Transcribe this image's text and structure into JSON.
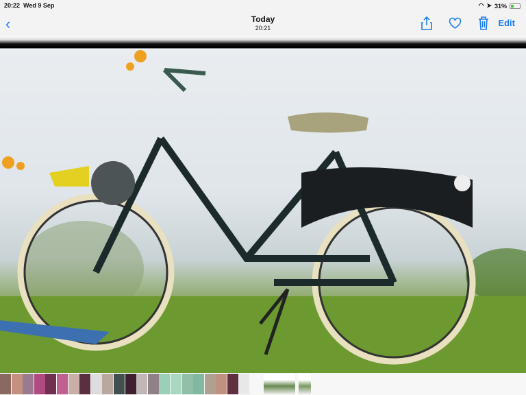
{
  "status": {
    "time": "20:22",
    "date": "Wed 9 Sep",
    "battery": "31%",
    "battery_level": 31
  },
  "nav": {
    "title": "Today",
    "subtitle": "20:21",
    "edit_label": "Edit"
  },
  "icons": [
    "back-chevron-icon",
    "share-icon",
    "heart-icon",
    "trash-icon",
    "wifi-icon",
    "location-icon",
    "battery-icon"
  ],
  "thumbnails": [
    "#8a6a60",
    "#c59080",
    "#9a7a90",
    "#b04a80",
    "#703050",
    "#c06090",
    "#c8b0a8",
    "#5a3040",
    "#ddd",
    "#b8a8a0",
    "#405050",
    "#402030",
    "#c0b8b8",
    "#908088",
    "#9ad0b8",
    "#a8d8c0",
    "#90c0a8",
    "#80b8a0",
    "#b0a090",
    "#c09080",
    "#603040",
    "#e8e8e8"
  ]
}
